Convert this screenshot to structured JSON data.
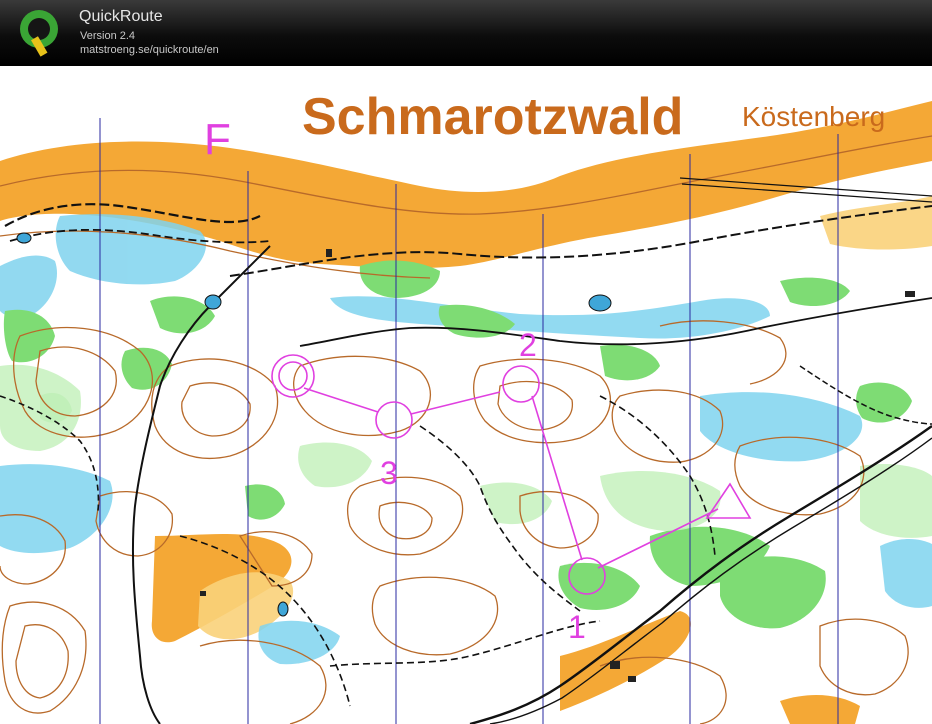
{
  "header": {
    "app_name": "QuickRoute",
    "version": "Version 2.4",
    "url": "matstroeng.se/quickroute/en",
    "logo_letter": "Q"
  },
  "map": {
    "title": "Schmarotzwald",
    "subtitle": "Köstenberg",
    "sheet_letter": "F",
    "controls": [
      {
        "label": "1",
        "shape": "circle"
      },
      {
        "label": "2",
        "shape": "circle"
      },
      {
        "label": "3",
        "shape": "circle"
      }
    ],
    "start_marker": "triangle",
    "finish_marker": "double-circle",
    "colors": {
      "course": "#e040e0",
      "title": "#c96a1c",
      "open_land": "#f4a836",
      "vegetation_green": "#6fd46a",
      "marsh_blue": "#5dc6e8",
      "contour_brown": "#b86a2a",
      "north_lines": "#2a2aa0",
      "track_black": "#111111"
    }
  }
}
